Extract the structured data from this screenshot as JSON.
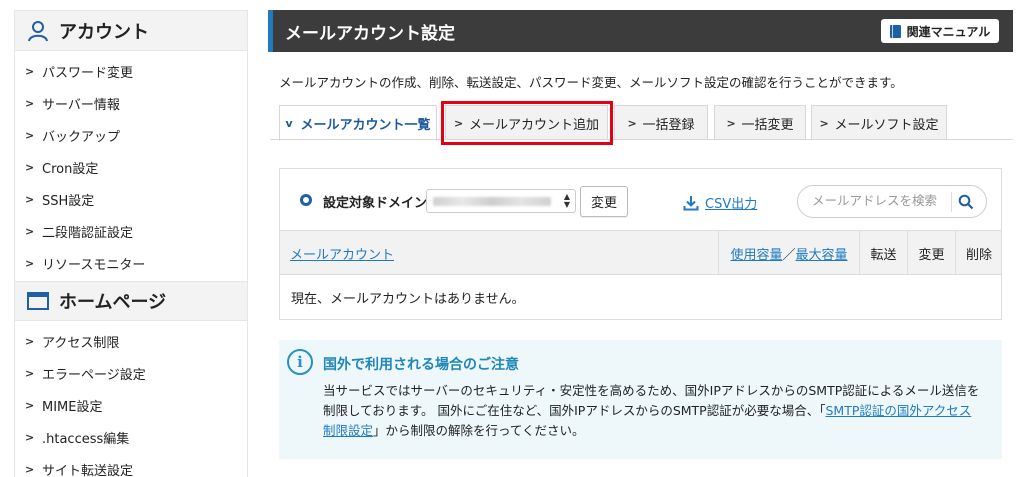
{
  "sidebar": {
    "account": {
      "title": "アカウント",
      "items": [
        "パスワード変更",
        "サーバー情報",
        "バックアップ",
        "Cron設定",
        "SSH設定",
        "二段階認証設定",
        "リソースモニター"
      ]
    },
    "homepage": {
      "title": "ホームページ",
      "items": [
        "アクセス制限",
        "エラーページ設定",
        "MIME設定",
        ".htaccess編集",
        "サイト転送設定"
      ]
    }
  },
  "header": {
    "title": "メールアカウント設定",
    "manual_button": "関連マニュアル"
  },
  "description": "メールアカウントの作成、削除、転送設定、パスワード変更、メールソフト設定の確認を行うことができます。",
  "tabs": [
    {
      "label": "メールアカウント一覧",
      "active": true
    },
    {
      "label": "メールアカウント追加",
      "active": false,
      "highlighted": true
    },
    {
      "label": "一括登録",
      "active": false
    },
    {
      "label": "一括変更",
      "active": false
    },
    {
      "label": "メールソフト設定",
      "active": false
    }
  ],
  "toolbar": {
    "domain_label": "設定対象ドメイン",
    "change_button": "変更",
    "csv_label": "CSV出力",
    "search_placeholder": "メールアドレスを検索"
  },
  "table": {
    "col_account": "メールアカウント",
    "col_used": "使用容量",
    "col_sep": "／",
    "col_max": "最大容量",
    "col_forward": "転送",
    "col_change": "変更",
    "col_delete": "削除",
    "empty_message": "現在、メールアカウントはありません。"
  },
  "notice": {
    "title": "国外で利用される場合のご注意",
    "line1": "当サービスではサーバーのセキュリティ・安定性を高めるため、国外IPアドレスからのSMTP認証によるメール送信を",
    "line2_prefix": "制限しております。 国外にご在住など、国外IPアドレスからのSMTP認証が必要な場合、「",
    "link": "SMTP認証の国外アクセス制限設定",
    "line2_suffix": "」から制限の解除を行ってください。"
  },
  "colors": {
    "accent": "#1f7ac2",
    "header_bg": "#3c3c3c",
    "highlight": "#e60012",
    "notice_bg": "#eef8fb"
  },
  "icons": [
    "user-icon",
    "window-icon",
    "book-icon",
    "download-icon",
    "search-icon",
    "info-icon",
    "chevron-right-icon",
    "chevron-down-icon"
  ]
}
